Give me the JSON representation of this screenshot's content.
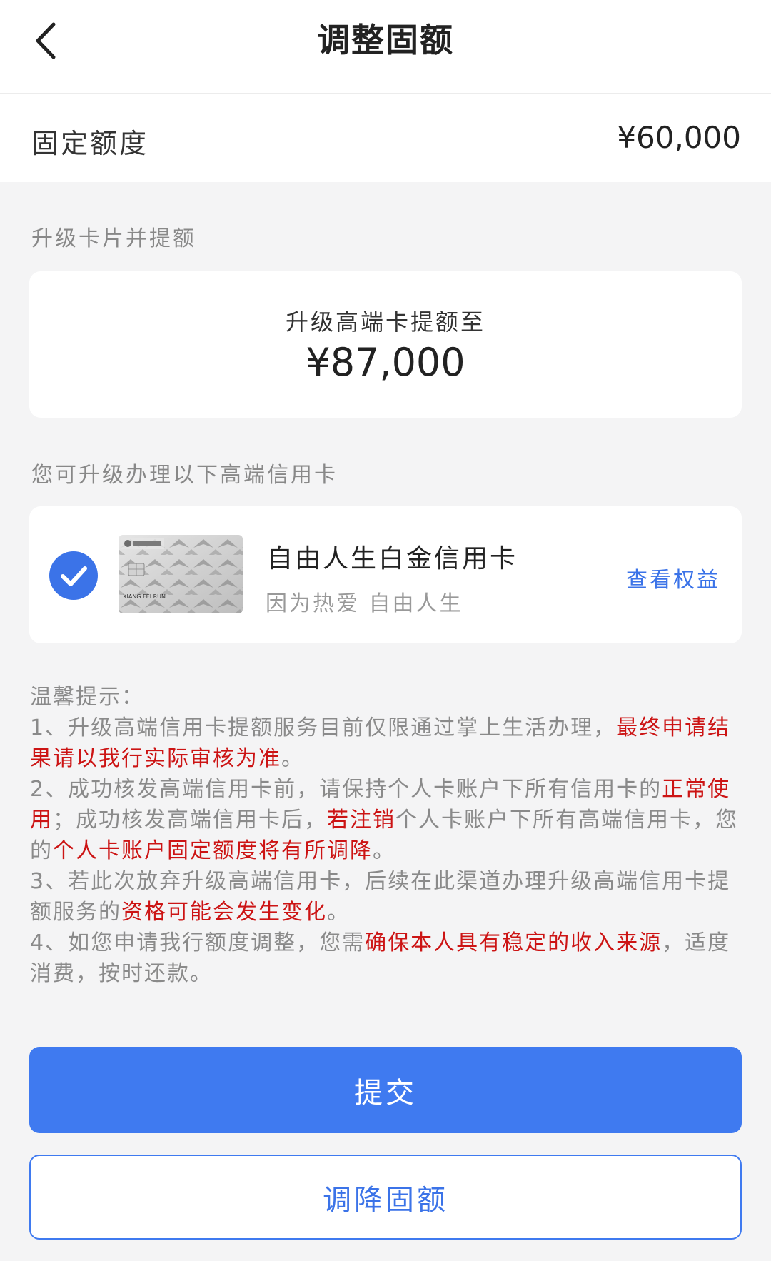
{
  "header": {
    "title": "调整固额"
  },
  "fixed_limit": {
    "label": "固定额度",
    "value": "¥60,000"
  },
  "upgrade_section": {
    "title": "升级卡片并提额",
    "card_label": "升级高端卡提额至",
    "amount": "¥87,000"
  },
  "cards_section": {
    "title": "您可升级办理以下高端信用卡",
    "card": {
      "name": "自由人生白金信用卡",
      "slogan": "因为热爱 自由人生",
      "link": "查看权益",
      "selected": true,
      "image_text": "XIANG FEI RUN"
    }
  },
  "notes": {
    "title": "温馨提示：",
    "items": [
      [
        {
          "t": "1、升级高端信用卡提额服务目前仅限通过掌上生活办理，",
          "red": false
        },
        {
          "t": "最终申请结果请以我行实际审核为准",
          "red": true
        },
        {
          "t": "。",
          "red": false
        }
      ],
      [
        {
          "t": "2、成功核发高端信用卡前，请保持个人卡账户下所有信用卡的",
          "red": false
        },
        {
          "t": "正常使用",
          "red": true
        },
        {
          "t": "；成功核发高端信用卡后，",
          "red": false
        },
        {
          "t": "若注销",
          "red": true
        },
        {
          "t": "个人卡账户下所有高端信用卡，您的",
          "red": false
        },
        {
          "t": "个人卡账户固定额度将有所调降",
          "red": true
        },
        {
          "t": "。",
          "red": false
        }
      ],
      [
        {
          "t": "3、若此次放弃升级高端信用卡，后续在此渠道办理升级高端信用卡提额服务的",
          "red": false
        },
        {
          "t": "资格可能会发生变化",
          "red": true
        },
        {
          "t": "。",
          "red": false
        }
      ],
      [
        {
          "t": "4、如您申请我行额度调整，您需",
          "red": false
        },
        {
          "t": "确保本人具有稳定的收入来源",
          "red": true
        },
        {
          "t": "，适度消费，按时还款。",
          "red": false
        }
      ]
    ]
  },
  "buttons": {
    "submit": "提交",
    "lower": "调降固额"
  }
}
